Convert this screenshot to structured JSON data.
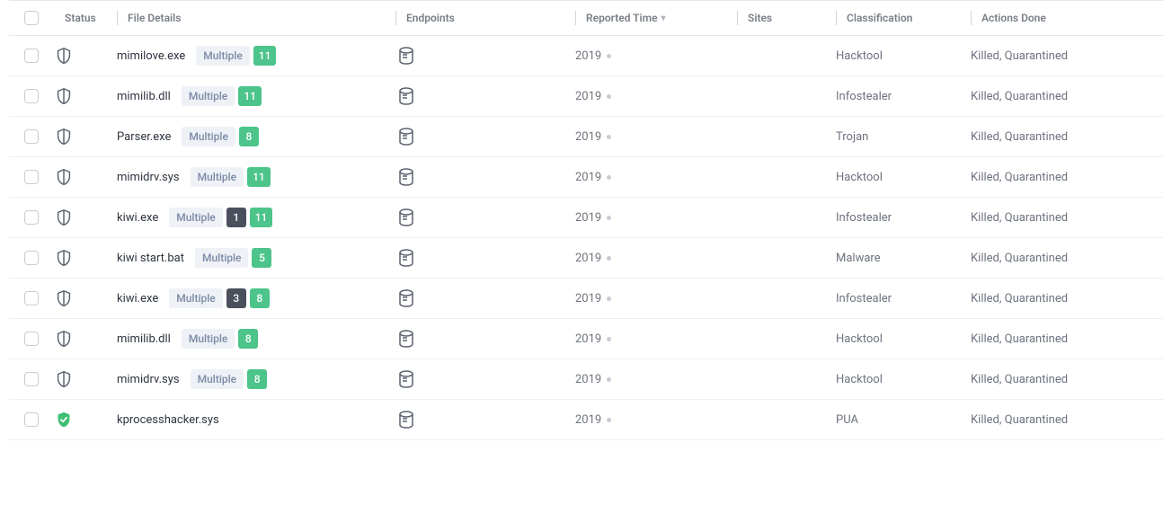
{
  "headers": {
    "status": "Status",
    "file": "File Details",
    "endpoints": "Endpoints",
    "time": "Reported Time",
    "sites": "Sites",
    "classification": "Classification",
    "actions": "Actions Done"
  },
  "labels": {
    "multiple": "Multiple"
  },
  "rows": [
    {
      "status": "threat",
      "file": "mimilove.exe",
      "counts": [
        {
          "style": "green",
          "n": "11"
        }
      ],
      "time": "2019",
      "classification": "Hacktool",
      "actions": "Killed, Quarantined"
    },
    {
      "status": "threat",
      "file": "mimilib.dll",
      "counts": [
        {
          "style": "green",
          "n": "11"
        }
      ],
      "time": "2019",
      "classification": "Infostealer",
      "actions": "Killed, Quarantined"
    },
    {
      "status": "threat",
      "file": "Parser.exe",
      "counts": [
        {
          "style": "green",
          "n": "8"
        }
      ],
      "time": "2019",
      "classification": "Trojan",
      "actions": "Killed, Quarantined"
    },
    {
      "status": "threat",
      "file": "mimidrv.sys",
      "counts": [
        {
          "style": "green",
          "n": "11"
        }
      ],
      "time": "2019",
      "classification": "Hacktool",
      "actions": "Killed, Quarantined"
    },
    {
      "status": "threat",
      "file": "kiwi.exe",
      "counts": [
        {
          "style": "dark",
          "n": "1"
        },
        {
          "style": "green",
          "n": "11"
        }
      ],
      "time": "2019",
      "classification": "Infostealer",
      "actions": "Killed, Quarantined"
    },
    {
      "status": "threat",
      "file": "kiwi start.bat",
      "counts": [
        {
          "style": "green",
          "n": "5"
        }
      ],
      "time": "2019",
      "classification": "Malware",
      "actions": "Killed, Quarantined"
    },
    {
      "status": "threat",
      "file": "kiwi.exe",
      "counts": [
        {
          "style": "dark",
          "n": "3"
        },
        {
          "style": "green",
          "n": "8"
        }
      ],
      "time": "2019",
      "classification": "Infostealer",
      "actions": "Killed, Quarantined"
    },
    {
      "status": "threat",
      "file": "mimilib.dll",
      "counts": [
        {
          "style": "green",
          "n": "8"
        }
      ],
      "time": "2019",
      "classification": "Hacktool",
      "actions": "Killed, Quarantined"
    },
    {
      "status": "threat",
      "file": "mimidrv.sys",
      "counts": [
        {
          "style": "green",
          "n": "8"
        }
      ],
      "time": "2019",
      "classification": "Hacktool",
      "actions": "Killed, Quarantined"
    },
    {
      "status": "resolved",
      "file": "kprocesshacker.sys",
      "counts": [],
      "time": "2019",
      "classification": "PUA",
      "actions": "Killed, Quarantined"
    }
  ]
}
